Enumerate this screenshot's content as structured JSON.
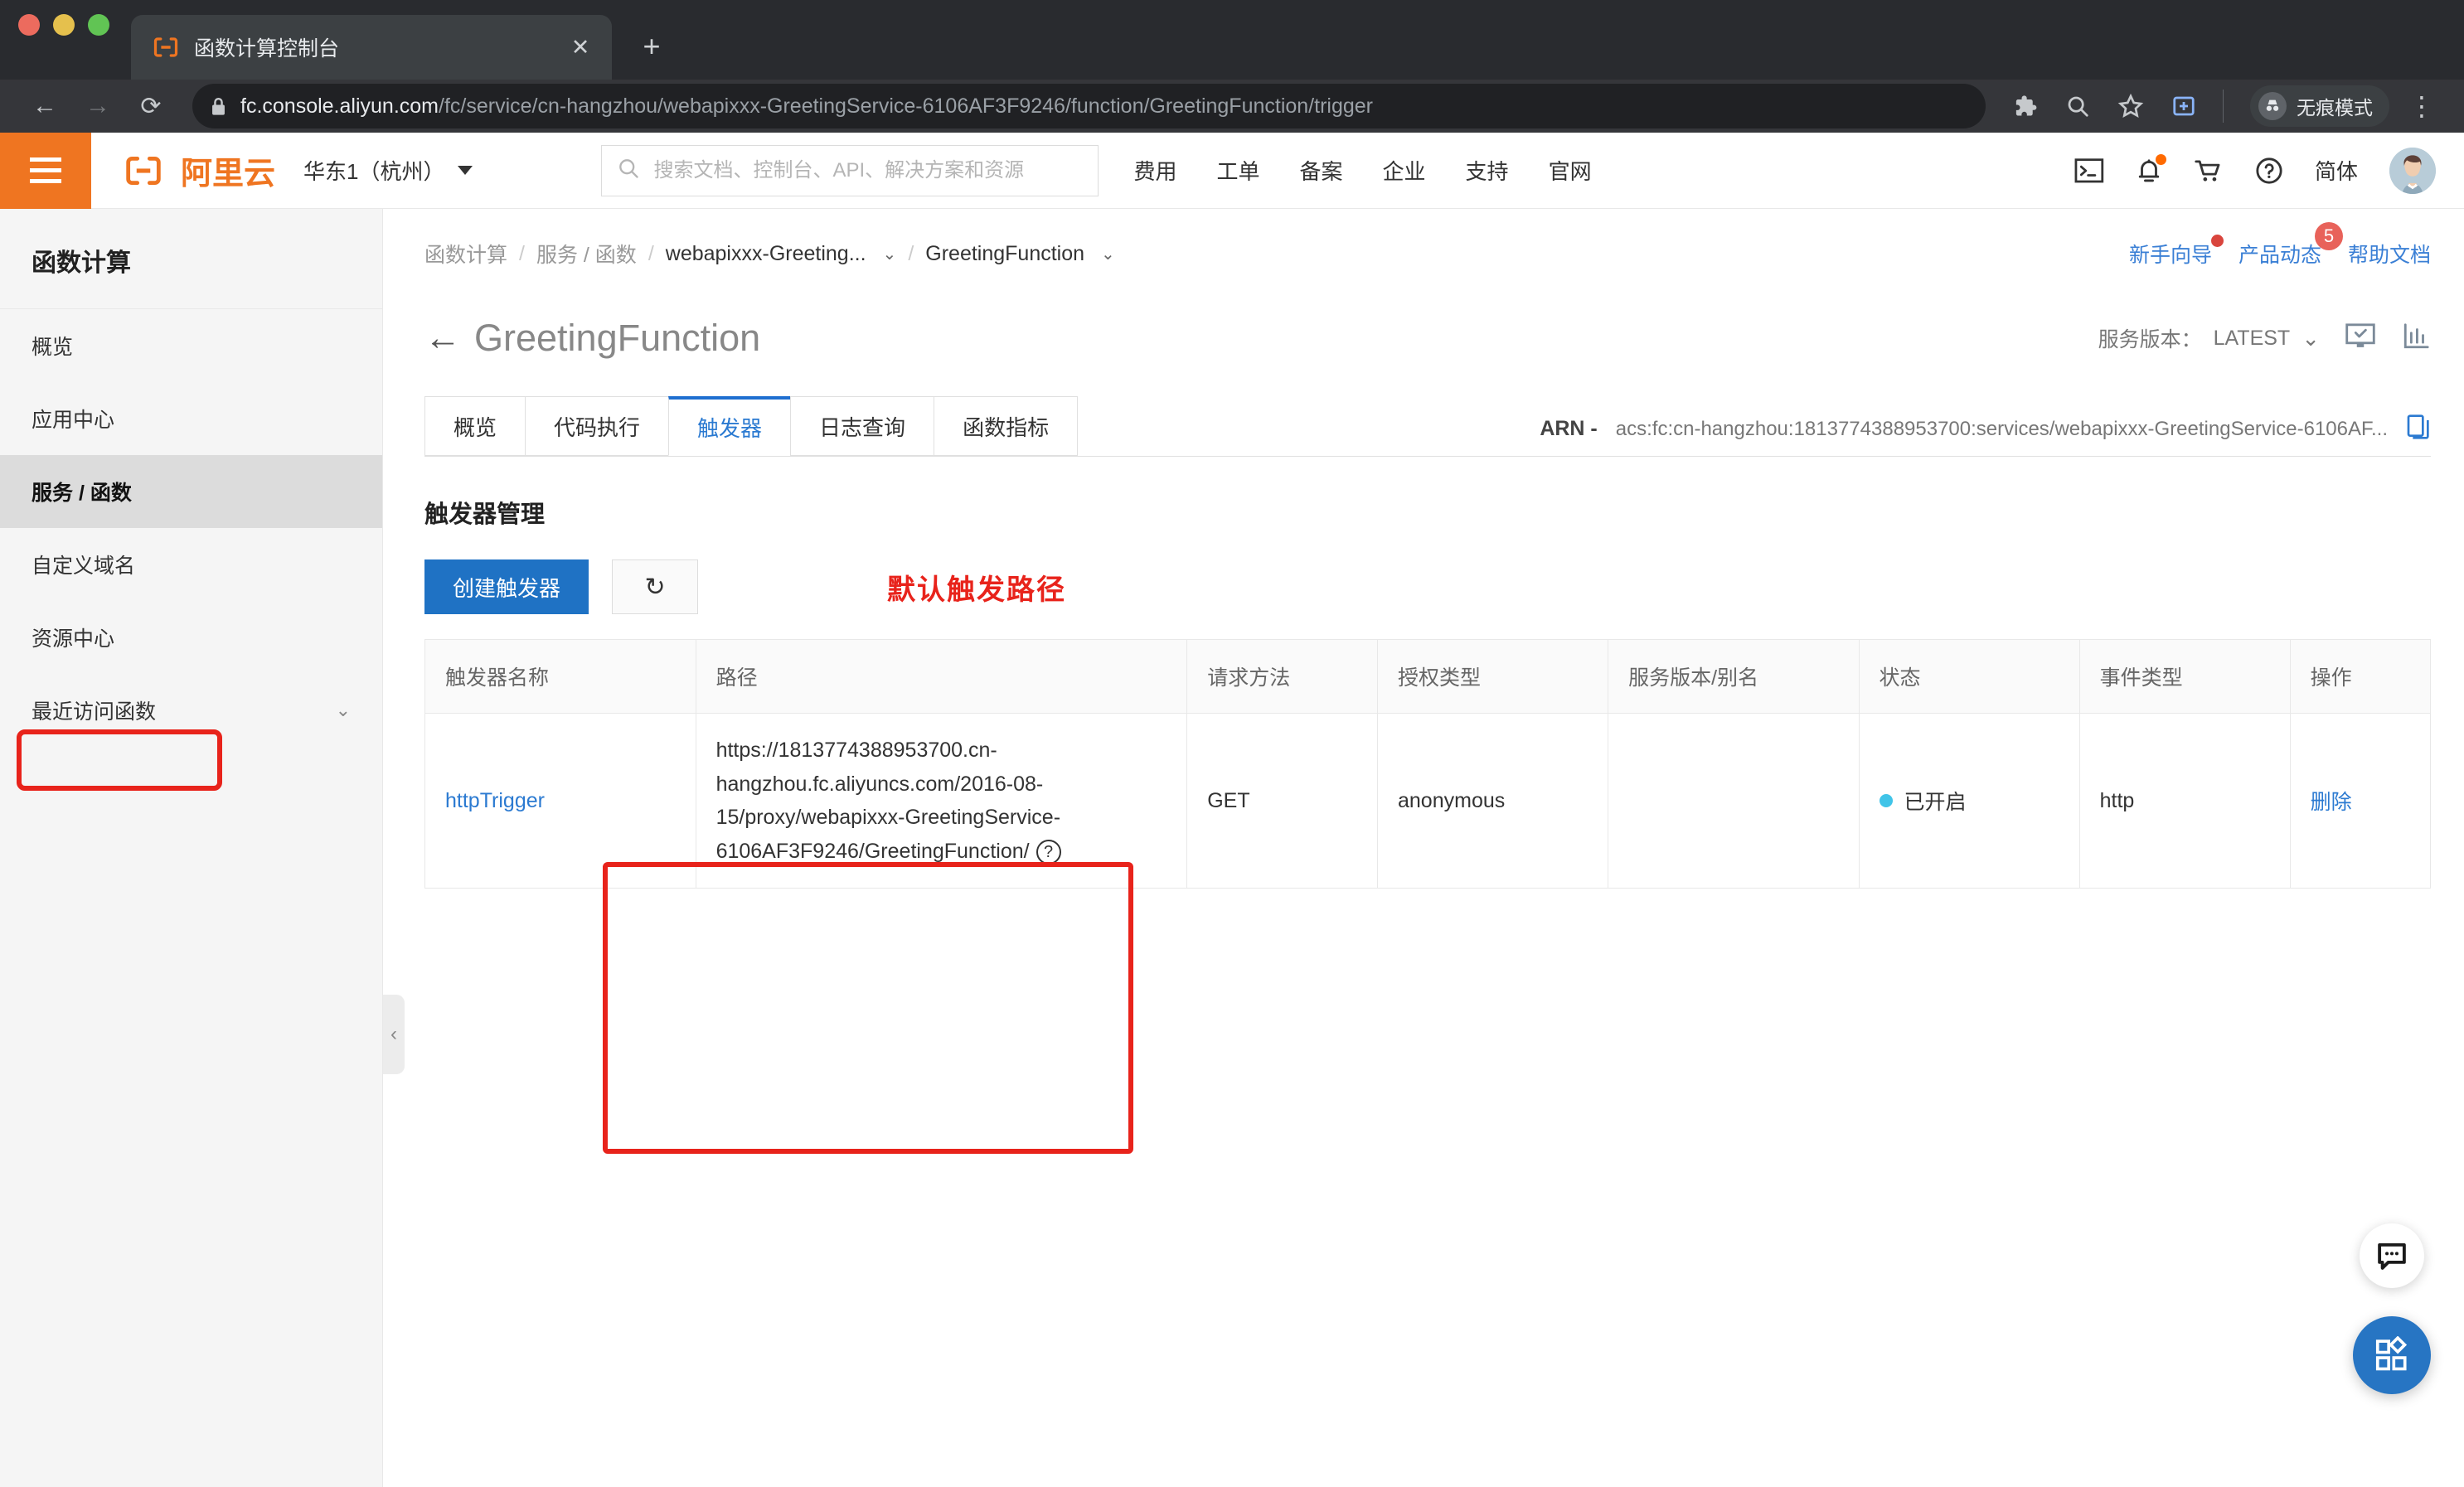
{
  "browser": {
    "tab_title": "函数计算控制台",
    "tab_favicon": "aliyun-logo-icon",
    "close_label": "✕",
    "new_tab_label": "+",
    "url_host": "fc.console.aliyun.com",
    "url_path": "/fc/service/cn-hangzhou/webapixxx-GreetingService-6106AF3F9246/function/GreetingFunction/trigger",
    "incognito_label": "无痕模式",
    "back_label": "←",
    "forward_label": "→",
    "reload_label": "⟳",
    "menu_label": "⋮"
  },
  "header": {
    "logo_text": "阿里云",
    "region": "华东1（杭州）",
    "search_placeholder": "搜索文档、控制台、API、解决方案和资源",
    "search_value": "",
    "nav": [
      {
        "label": "费用"
      },
      {
        "label": "工单"
      },
      {
        "label": "备案"
      },
      {
        "label": "企业"
      },
      {
        "label": "支持"
      },
      {
        "label": "官网"
      }
    ],
    "language": "简体",
    "icons": [
      "terminal-icon",
      "bell-icon",
      "cart-icon",
      "help-icon"
    ]
  },
  "sidebar": {
    "title": "函数计算",
    "items": [
      {
        "label": "概览",
        "active": false,
        "expandable": false,
        "highlighted": false
      },
      {
        "label": "应用中心",
        "active": false,
        "expandable": false,
        "highlighted": false
      },
      {
        "label": "服务 / 函数",
        "active": true,
        "expandable": false,
        "highlighted": false
      },
      {
        "label": "自定义域名",
        "active": false,
        "expandable": false,
        "highlighted": true
      },
      {
        "label": "资源中心",
        "active": false,
        "expandable": false,
        "highlighted": false
      },
      {
        "label": "最近访问函数",
        "active": false,
        "expandable": true,
        "highlighted": false
      }
    ],
    "chevron": "⌄"
  },
  "breadcrumb": {
    "items": [
      {
        "label": "函数计算",
        "muted": true,
        "chevron": false
      },
      {
        "label": "服务 / 函数",
        "muted": true,
        "chevron": false
      },
      {
        "label": "webapixxx-Greeting...",
        "muted": false,
        "chevron": true
      },
      {
        "label": "GreetingFunction",
        "muted": false,
        "chevron": true
      }
    ],
    "separator": "/",
    "right_links": [
      {
        "label": "新手向导",
        "badge": "",
        "badge_type": "dot"
      },
      {
        "label": "产品动态",
        "badge": "5",
        "badge_type": "number"
      },
      {
        "label": "帮助文档",
        "badge": "",
        "badge_type": "none"
      }
    ]
  },
  "page": {
    "back_arrow": "←",
    "title": "GreetingFunction",
    "service_version_label": "服务版本：",
    "service_version_value": "LATEST",
    "version_chevron": "⌄",
    "title_icons": [
      "monitor-check-icon",
      "bar-chart-icon"
    ]
  },
  "tabs": [
    {
      "label": "概览",
      "active": false
    },
    {
      "label": "代码执行",
      "active": false
    },
    {
      "label": "触发器",
      "active": true
    },
    {
      "label": "日志查询",
      "active": false
    },
    {
      "label": "函数指标",
      "active": false
    }
  ],
  "arn": {
    "label": "ARN -",
    "value": "acs:fc:cn-hangzhou:1813774388953700:services/webapixxx-GreetingService-6106AF...",
    "copy_icon": "copy-icon"
  },
  "trigger_section": {
    "title": "触发器管理",
    "create_button": "创建触发器",
    "refresh_icon": "↻",
    "annotation": "默认触发路径"
  },
  "table": {
    "columns": [
      "触发器名称",
      "路径",
      "请求方法",
      "授权类型",
      "服务版本/别名",
      "状态",
      "事件类型",
      "操作"
    ],
    "rows": [
      {
        "name": "httpTrigger",
        "path": "https://1813774388953700.cn-hangzhou.fc.aliyuncs.com/2016-08-15/proxy/webapixxx-GreetingService-6106AF3F9246/GreetingFunction/",
        "path_help_icon": "?",
        "method": "GET",
        "auth_type": "anonymous",
        "service_version": "",
        "status": "已开启",
        "event_type": "http",
        "action": "删除"
      }
    ]
  },
  "floating": {
    "chat_icon": "chat-bubble-icon",
    "apps_icon": "apps-grid-icon"
  },
  "colors": {
    "accent_orange": "#ef7521",
    "link_blue": "#2b7ad1",
    "primary_blue": "#1f72c4",
    "annotation_red": "#e8231b",
    "status_cyan": "#40c4e8"
  },
  "collapse_handle": "‹"
}
